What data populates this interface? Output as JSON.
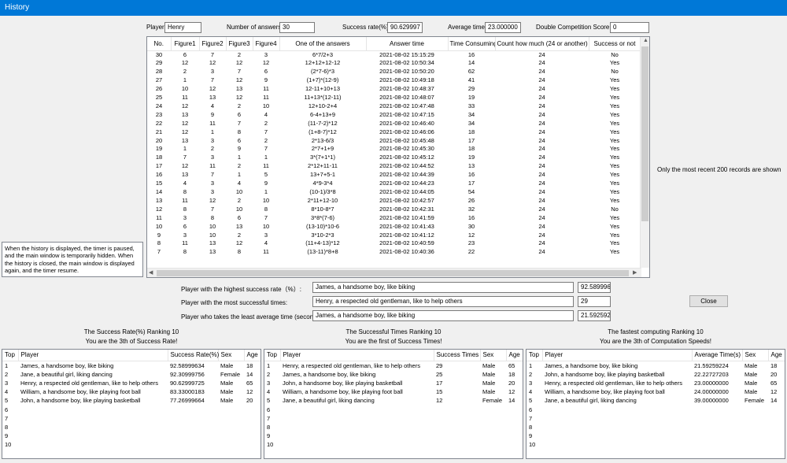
{
  "window": {
    "title": "History"
  },
  "summary": {
    "player_label": "Player",
    "player": "Henry",
    "answers_label": "Number of answers",
    "answers": "30",
    "success_rate_label": "Success rate(%)",
    "success_rate": "90.629997",
    "avg_time_label": "Average time",
    "avg_time": "23.000000",
    "double_score_label": "Double Competition Score",
    "double_score": "0"
  },
  "history": {
    "columns": [
      "No.",
      "Figure1",
      "Figure2",
      "Figure3",
      "Figure4",
      "One of the answers",
      "Answer time",
      "Time Consuming",
      "Count how much (24 or another)",
      "Success or not"
    ],
    "rows": [
      [
        "30",
        "6",
        "7",
        "2",
        "3",
        "6*7/2+3",
        "2021-08-02 15:15:29",
        "16",
        "24",
        "No"
      ],
      [
        "29",
        "12",
        "12",
        "12",
        "12",
        "12+12+12-12",
        "2021-08-02 10:50:34",
        "14",
        "24",
        "Yes"
      ],
      [
        "28",
        "2",
        "3",
        "7",
        "6",
        "(2*7-6)*3",
        "2021-08-02 10:50:20",
        "62",
        "24",
        "No"
      ],
      [
        "27",
        "1",
        "7",
        "12",
        "9",
        "(1+7)*(12-9)",
        "2021-08-02 10:49:18",
        "41",
        "24",
        "Yes"
      ],
      [
        "26",
        "10",
        "12",
        "13",
        "11",
        "12-11+10+13",
        "2021-08-02 10:48:37",
        "29",
        "24",
        "Yes"
      ],
      [
        "25",
        "11",
        "13",
        "12",
        "11",
        "11+13*(12-11)",
        "2021-08-02 10:48:07",
        "19",
        "24",
        "Yes"
      ],
      [
        "24",
        "12",
        "4",
        "2",
        "10",
        "12+10-2+4",
        "2021-08-02 10:47:48",
        "33",
        "24",
        "Yes"
      ],
      [
        "23",
        "13",
        "9",
        "6",
        "4",
        "6-4+13+9",
        "2021-08-02 10:47:15",
        "34",
        "24",
        "Yes"
      ],
      [
        "22",
        "12",
        "11",
        "7",
        "2",
        "(11-7-2)*12",
        "2021-08-02 10:46:40",
        "34",
        "24",
        "Yes"
      ],
      [
        "21",
        "12",
        "1",
        "8",
        "7",
        "(1+8-7)*12",
        "2021-08-02 10:46:06",
        "18",
        "24",
        "Yes"
      ],
      [
        "20",
        "13",
        "3",
        "6",
        "2",
        "2*13-6/3",
        "2021-08-02 10:45:48",
        "17",
        "24",
        "Yes"
      ],
      [
        "19",
        "1",
        "2",
        "9",
        "7",
        "2*7+1+9",
        "2021-08-02 10:45:30",
        "18",
        "24",
        "Yes"
      ],
      [
        "18",
        "7",
        "3",
        "1",
        "1",
        "3*(7+1*1)",
        "2021-08-02 10:45:12",
        "19",
        "24",
        "Yes"
      ],
      [
        "17",
        "12",
        "11",
        "2",
        "11",
        "2*12+11-11",
        "2021-08-02 10:44:52",
        "13",
        "24",
        "Yes"
      ],
      [
        "16",
        "13",
        "7",
        "1",
        "5",
        "13+7+5-1",
        "2021-08-02 10:44:39",
        "16",
        "24",
        "Yes"
      ],
      [
        "15",
        "4",
        "3",
        "4",
        "9",
        "4*9-3*4",
        "2021-08-02 10:44:23",
        "17",
        "24",
        "Yes"
      ],
      [
        "14",
        "8",
        "3",
        "10",
        "1",
        "(10-1)/3*8",
        "2021-08-02 10:44:05",
        "54",
        "24",
        "Yes"
      ],
      [
        "13",
        "11",
        "12",
        "2",
        "10",
        "2*11+12-10",
        "2021-08-02 10:42:57",
        "26",
        "24",
        "Yes"
      ],
      [
        "12",
        "8",
        "7",
        "10",
        "8",
        "8*10-8*7",
        "2021-08-02 10:42:31",
        "32",
        "24",
        "No"
      ],
      [
        "11",
        "3",
        "8",
        "6",
        "7",
        "3*8*(7-6)",
        "2021-08-02 10:41:59",
        "16",
        "24",
        "Yes"
      ],
      [
        "10",
        "6",
        "10",
        "13",
        "10",
        "(13-10)*10-6",
        "2021-08-02 10:41:43",
        "30",
        "24",
        "Yes"
      ],
      [
        "9",
        "3",
        "10",
        "2",
        "3",
        "3*10-2*3",
        "2021-08-02 10:41:12",
        "12",
        "24",
        "Yes"
      ],
      [
        "8",
        "11",
        "13",
        "12",
        "4",
        "(11+4-13)*12",
        "2021-08-02 10:40:59",
        "23",
        "24",
        "Yes"
      ],
      [
        "7",
        "8",
        "13",
        "8",
        "11",
        "(13-11)*8+8",
        "2021-08-02 10:40:36",
        "22",
        "24",
        "Yes"
      ]
    ]
  },
  "side_note": "Only the most recent 200 records are shown",
  "left_note": "When the history is displayed, the timer is paused, and the main window is temporarily hidden. When the history is closed, the main window is displayed again, and the timer resume.",
  "bests": {
    "highest_rate_label": "Player with the highest success rate（%）:",
    "highest_rate_player": "James, a handsome boy, like biking",
    "highest_rate_value": "92.589996",
    "most_success_label": "Player with the most successful times:",
    "most_success_player": "Henry, a respected old gentleman, like to help others",
    "most_success_value": "29",
    "least_avg_label": "Player who takes the least average time (seconds):",
    "least_avg_player": "James, a handsome boy, like biking",
    "least_avg_value": "21.592592"
  },
  "close_button": "Close",
  "rankings": [
    {
      "title": "The Success Rate(%) Ranking  10",
      "subtitle": "You are the 3th of Success Rate!",
      "columns": [
        "Top",
        "Player",
        "Success Rate(%)",
        "Sex",
        "Age"
      ],
      "rows": [
        [
          "1",
          "James, a handsome boy, like biking",
          "92.58999634",
          "Male",
          "18"
        ],
        [
          "2",
          "Jane, a beautiful girl, liking dancing",
          "92.30999756",
          "Female",
          "14"
        ],
        [
          "3",
          "Henry, a respected old gentleman, like to help others",
          "90.62999725",
          "Male",
          "65"
        ],
        [
          "4",
          "William, a handsome boy, like playing foot ball",
          "83.33000183",
          "Male",
          "12"
        ],
        [
          "5",
          "John, a handsome boy, like playing basketball",
          "77.26999664",
          "Male",
          "20"
        ],
        [
          "6",
          "",
          "",
          "",
          ""
        ],
        [
          "7",
          "",
          "",
          "",
          ""
        ],
        [
          "8",
          "",
          "",
          "",
          ""
        ],
        [
          "9",
          "",
          "",
          "",
          ""
        ],
        [
          "10",
          "",
          "",
          "",
          ""
        ]
      ]
    },
    {
      "title": "The Successful Times Ranking  10",
      "subtitle": "You are the first of Success Times!",
      "columns": [
        "Top",
        "Player",
        "Success Times",
        "Sex",
        "Age"
      ],
      "rows": [
        [
          "1",
          "Henry, a respected old gentleman, like to help others",
          "29",
          "Male",
          "65"
        ],
        [
          "2",
          "James, a handsome boy, like biking",
          "25",
          "Male",
          "18"
        ],
        [
          "3",
          "John, a handsome boy, like playing basketball",
          "17",
          "Male",
          "20"
        ],
        [
          "4",
          "William, a handsome boy, like playing foot ball",
          "15",
          "Male",
          "12"
        ],
        [
          "5",
          "Jane, a beautiful girl, liking dancing",
          "12",
          "Female",
          "14"
        ],
        [
          "6",
          "",
          "",
          "",
          ""
        ],
        [
          "7",
          "",
          "",
          "",
          ""
        ],
        [
          "8",
          "",
          "",
          "",
          ""
        ],
        [
          "9",
          "",
          "",
          "",
          ""
        ],
        [
          "10",
          "",
          "",
          "",
          ""
        ]
      ]
    },
    {
      "title": "The fastest computing  Ranking  10",
      "subtitle": "You are the 3th of Computation Speeds!",
      "columns": [
        "Top",
        "Player",
        "Average Time(s)",
        "Sex",
        "Age"
      ],
      "rows": [
        [
          "1",
          "James, a handsome boy, like biking",
          "21.59259224",
          "Male",
          "18"
        ],
        [
          "2",
          "John, a handsome boy, like playing basketball",
          "22.22727203",
          "Male",
          "20"
        ],
        [
          "3",
          "Henry, a respected old gentleman, like to help others",
          "23.00000000",
          "Male",
          "65"
        ],
        [
          "4",
          "William, a handsome boy, like playing foot ball",
          "24.00000000",
          "Male",
          "12"
        ],
        [
          "5",
          "Jane, a beautiful girl, liking dancing",
          "39.00000000",
          "Female",
          "14"
        ],
        [
          "6",
          "",
          "",
          "",
          ""
        ],
        [
          "7",
          "",
          "",
          "",
          ""
        ],
        [
          "8",
          "",
          "",
          "",
          ""
        ],
        [
          "9",
          "",
          "",
          "",
          ""
        ],
        [
          "10",
          "",
          "",
          "",
          ""
        ]
      ]
    }
  ]
}
